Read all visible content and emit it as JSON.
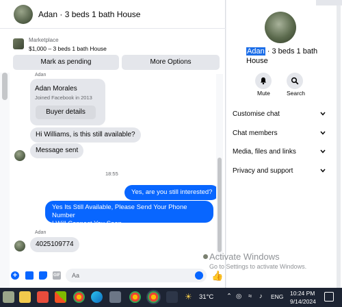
{
  "chat": {
    "header_title": "Adan · 3 beds 1 bath House",
    "info_icon": "i",
    "marketplace_label": "Marketplace",
    "listing_title": "$1,000 – 3 beds 1 bath House",
    "mark_pending": "Mark as pending",
    "more_options": "More Options",
    "sender_name_top": "Adan",
    "card_name": "Adan Morales",
    "card_joined": "Joined Facebook in 2013",
    "buyer_details": "Buyer details",
    "msg_1": "Hi Williams, is this still available?",
    "msg_2": "Message sent",
    "timestamp": "18:55",
    "msg_3": "Yes, are you still interested?",
    "msg_4_line1": "Yes Its Still Available, Please Send Your Phone Number",
    "msg_4_line2": "I Will Connect You Soon",
    "sender_name_bottom": "Adan",
    "msg_5": "4025109774",
    "input_placeholder": "Aa",
    "gif_label": "GIF"
  },
  "info_panel": {
    "name_highlight": "Adan",
    "name_rest": " · 3 beds 1 bath House",
    "mute": "Mute",
    "search": "Search",
    "menu": [
      "Customise chat",
      "Chat members",
      "Media, files and links",
      "Privacy and support"
    ]
  },
  "watermark": {
    "line1": "Activate Windows",
    "line2": "Go to Settings to activate Windows."
  },
  "taskbar": {
    "temperature": "31°C",
    "language": "ENG",
    "time": "10:24 PM",
    "date": "9/14/2024"
  },
  "colors": {
    "accent": "#0866ff",
    "bubble_in": "#e4e6eb",
    "taskbar": "#1d2433"
  }
}
